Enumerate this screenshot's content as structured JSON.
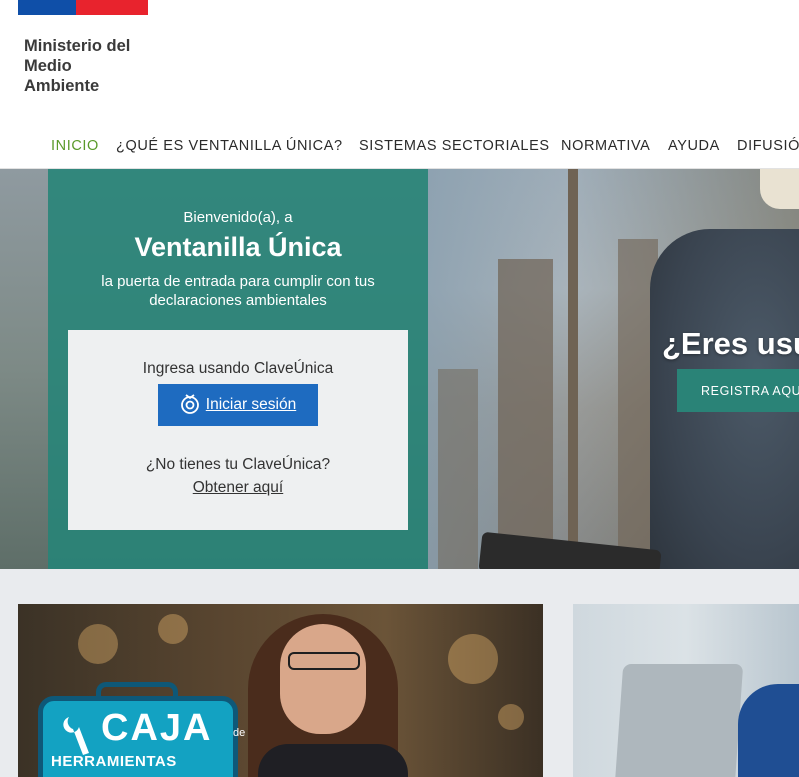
{
  "header": {
    "logo_lines": [
      "Ministerio del",
      "Medio",
      "Ambiente"
    ],
    "flag_colors": {
      "blue": "#0f4fa8",
      "red": "#e8232d"
    }
  },
  "nav": {
    "items": [
      {
        "label": "INICIO",
        "active": true
      },
      {
        "label": "¿QUÉ ES VENTANILLA ÚNICA?",
        "active": false
      },
      {
        "label": "SISTEMAS SECTORIALES",
        "active": false
      },
      {
        "label": "NORMATIVA",
        "active": false
      },
      {
        "label": "AYUDA",
        "active": false
      },
      {
        "label": "DIFUSIÓ",
        "active": false
      }
    ],
    "active_color": "#5a9a2a"
  },
  "hero": {
    "welcome": "Bienvenido(a), a",
    "title": "Ventanilla Única",
    "subtitle": "la puerta de entrada para cumplir con tus declaraciones ambientales",
    "login": {
      "prompt": "Ingresa usando ClaveÚnica",
      "button_label": "Iniciar sesión",
      "button_icon": "claveunica-icon",
      "no_account": "¿No tienes tu ClaveÚnica?",
      "obtain_link": "Obtener aquí"
    },
    "promo_heading": "¿Eres usu",
    "register_button": "REGISTRA AQUÍ",
    "panel_color": "#268478"
  },
  "cards": {
    "toolbox": {
      "brand_word": "CAJA",
      "brand_de": "de",
      "brand_sub": "HERRAMIENTAS"
    }
  }
}
